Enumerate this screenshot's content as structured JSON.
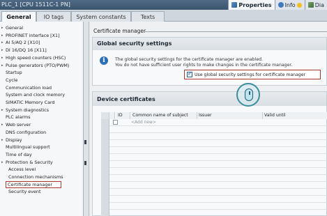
{
  "titlebar": {
    "title": "PLC_1 [CPU 1511C-1 PN]",
    "tabs": [
      {
        "label": "Properties",
        "icon": "properties-icon"
      },
      {
        "label": "Info",
        "icon": "info-icon"
      },
      {
        "label": "Dia",
        "icon": "diagnostics-icon"
      }
    ]
  },
  "tabs": [
    "General",
    "IO tags",
    "System constants",
    "Texts"
  ],
  "sidebar": {
    "items": [
      {
        "label": "General",
        "expand": true,
        "indent": 0
      },
      {
        "label": "PROFINET interface [X1]",
        "expand": true,
        "indent": 0
      },
      {
        "label": "AI 5/AQ 2 [X10]",
        "expand": true,
        "indent": 0
      },
      {
        "label": "DI 16/DQ 16 [X11]",
        "expand": true,
        "indent": 0
      },
      {
        "label": "High speed counters (HSC)",
        "expand": true,
        "indent": 0
      },
      {
        "label": "Pulse generators (PTO/PWM)",
        "expand": true,
        "indent": 0
      },
      {
        "label": "Startup",
        "expand": false,
        "indent": 1
      },
      {
        "label": "Cycle",
        "expand": false,
        "indent": 1
      },
      {
        "label": "Communication load",
        "expand": false,
        "indent": 1
      },
      {
        "label": "System and clock memory",
        "expand": false,
        "indent": 1
      },
      {
        "label": "SIMATIC Memory Card",
        "expand": false,
        "indent": 1
      },
      {
        "label": "System diagnostics",
        "expand": true,
        "indent": 0
      },
      {
        "label": "PLC alarms",
        "expand": false,
        "indent": 1
      },
      {
        "label": "Web server",
        "expand": true,
        "indent": 0
      },
      {
        "label": "DNS configuration",
        "expand": false,
        "indent": 1
      },
      {
        "label": "Display",
        "expand": true,
        "indent": 0
      },
      {
        "label": "Multilingual support",
        "expand": false,
        "indent": 1
      },
      {
        "label": "Time of day",
        "expand": false,
        "indent": 1
      },
      {
        "label": "Protection & Security",
        "expand": true,
        "indent": 0
      },
      {
        "label": "Access level",
        "expand": false,
        "indent": 2
      },
      {
        "label": "Connection mechanisms",
        "expand": false,
        "indent": 2
      },
      {
        "label": "Certificate manager",
        "expand": false,
        "indent": 2,
        "selected": true
      },
      {
        "label": "Security event",
        "expand": false,
        "indent": 2
      }
    ]
  },
  "main": {
    "section_title": "Certificate manager",
    "global": {
      "title": "Global security settings",
      "line1": "The global security settings for the certificate manager are enabled.",
      "line2": "You do not have sufficient user rights to make changes in the certificate manager.",
      "checkbox_label": "Use global security settings for certificate manager",
      "checked": true
    },
    "device": {
      "title": "Device certificates",
      "columns": [
        "ID",
        "Common name of subject",
        "Issuer",
        "Valid until"
      ],
      "add_new": "<Add new>"
    }
  },
  "colors": {
    "highlight": "#a6382e",
    "accent": "#2b6fb8"
  }
}
